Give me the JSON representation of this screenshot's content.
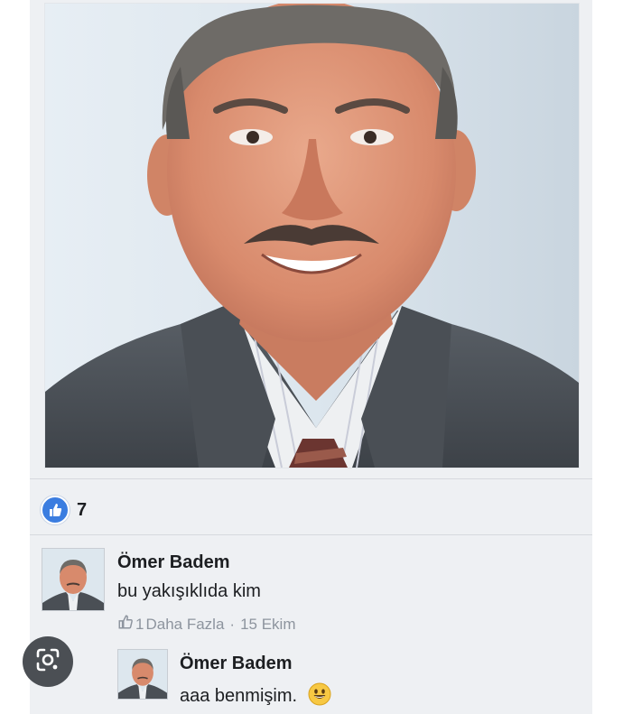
{
  "post": {
    "like_count": "7"
  },
  "comments": [
    {
      "author": "Ömer Badem",
      "text": "bu yakışıklıda kim",
      "like_count": "1",
      "more_label": "Daha Fazla",
      "separator": "·",
      "date": "15 Ekim"
    },
    {
      "author": "Ömer Badem",
      "text": "aaa benmişim.",
      "emoji": "smiling-face-icon"
    }
  ],
  "colors": {
    "like_blue": "#3b7de0",
    "meta_gray": "#8d949e",
    "card_bg": "#eef0f3"
  }
}
